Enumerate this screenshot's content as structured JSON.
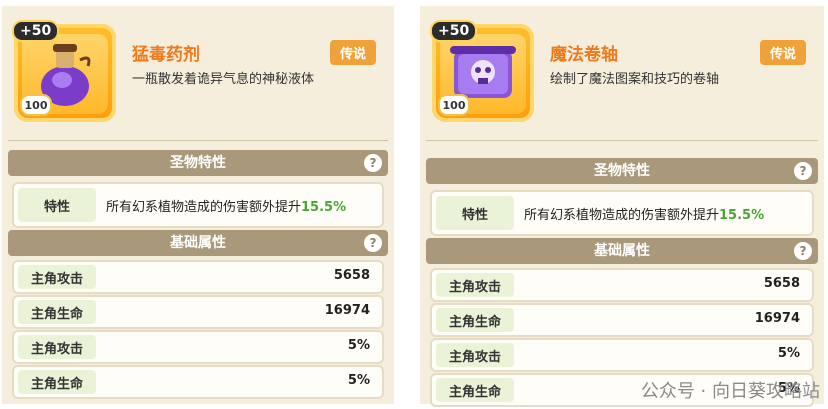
{
  "cards": [
    {
      "plus": "+50",
      "level": "100",
      "title": "猛毒药剂",
      "desc": "一瓶散发着诡异气息的神秘液体",
      "rarity": "传说",
      "section1": "圣物特性",
      "trait_key": "特性",
      "trait_text": "所有幻系植物造成的伤害额外提升",
      "trait_pct": "15.5%",
      "section2": "基础属性",
      "stats": [
        {
          "k": "主角攻击",
          "v": "5658"
        },
        {
          "k": "主角生命",
          "v": "16974"
        },
        {
          "k": "主角攻击",
          "v": "5%"
        },
        {
          "k": "主角生命",
          "v": "5%"
        }
      ]
    },
    {
      "plus": "+50",
      "level": "100",
      "title": "魔法卷轴",
      "desc": "绘制了魔法图案和技巧的卷轴",
      "rarity": "传说",
      "section1": "圣物特性",
      "trait_key": "特性",
      "trait_text": "所有幻系植物造成的伤害额外提升",
      "trait_pct": "15.5%",
      "section2": "基础属性",
      "stats": [
        {
          "k": "主角攻击",
          "v": "5658"
        },
        {
          "k": "主角生命",
          "v": "16974"
        },
        {
          "k": "主角攻击",
          "v": "5%"
        },
        {
          "k": "主角生命",
          "v": "5%"
        }
      ]
    }
  ],
  "watermark": "公众号 · 向日葵攻略站"
}
